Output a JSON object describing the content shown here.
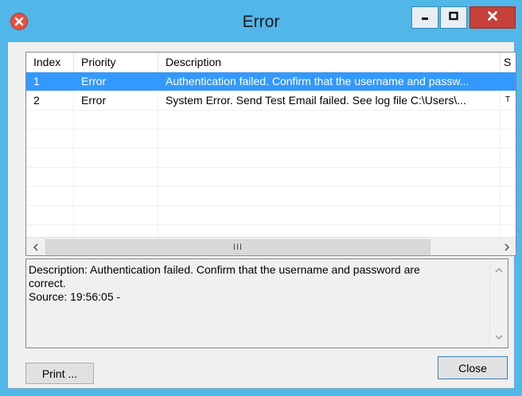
{
  "window": {
    "title": "Error",
    "icons": {
      "app": "error-icon",
      "minimize": "minimize-icon",
      "maximize": "maximize-icon",
      "close": "close-icon"
    },
    "colors": {
      "frame": "#51b7e8",
      "close_button": "#c7403a",
      "selection": "#3399ff"
    }
  },
  "list": {
    "columns": [
      "Index",
      "Priority",
      "Description",
      "S"
    ],
    "rows": [
      {
        "index": "1",
        "priority": "Error",
        "description": "Authentication failed. Confirm that the username and passw...",
        "extra": "",
        "selected": true
      },
      {
        "index": "2",
        "priority": "Error",
        "description": "System Error. Send Test Email failed. See log file C:\\Users\\...",
        "extra": "T",
        "selected": false
      }
    ],
    "hscroll_grip": "III"
  },
  "details": {
    "line1": "Description: Authentication failed. Confirm that the username and password are",
    "line2": "correct.",
    "line3": "Source:  19:56:05 -"
  },
  "buttons": {
    "print": "Print ...",
    "close": "Close"
  }
}
